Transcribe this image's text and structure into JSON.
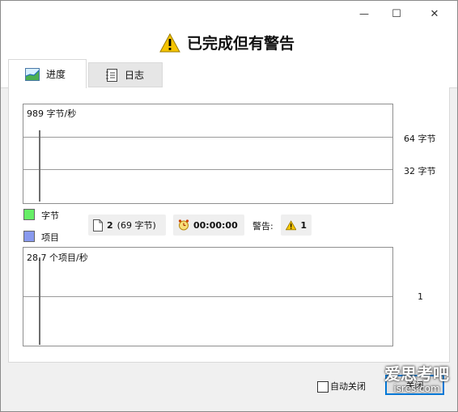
{
  "window": {
    "buttons": {
      "minimize": "—",
      "maximize": "☐",
      "close": "✕"
    },
    "title": "已完成但有警告",
    "title_icon": "warning-icon"
  },
  "tabs": [
    {
      "label": "进度",
      "icon": "progress-chart-icon",
      "active": true
    },
    {
      "label": "日志",
      "icon": "log-book-icon",
      "active": false
    }
  ],
  "bytes_graph": {
    "rate_label": "989 字节/秒",
    "scale_labels": [
      "64 字节",
      "32 字节"
    ],
    "color": "#66ee66"
  },
  "items_graph": {
    "rate_label": "28.7 个项目/秒",
    "scale_labels": [
      "1"
    ],
    "color": "#8899ee"
  },
  "legend": [
    {
      "label": "字节",
      "color": "#66ee66"
    },
    {
      "label": "项目",
      "color": "#8899ee"
    }
  ],
  "stats": {
    "files": {
      "count": "2",
      "size": "(69 字节)",
      "icon": "file-icon"
    },
    "elapsed": {
      "value": "00:00:00",
      "icon": "alarm-clock-icon"
    },
    "warnings": {
      "label": "警告:",
      "count": "1",
      "icon": "warning-icon"
    }
  },
  "bottom": {
    "auto_close_label": "自动关闭",
    "auto_close_checked": false,
    "close_button": "关闭"
  },
  "watermark": {
    "line1": "爱思考吧",
    "line2": "isres.com"
  }
}
